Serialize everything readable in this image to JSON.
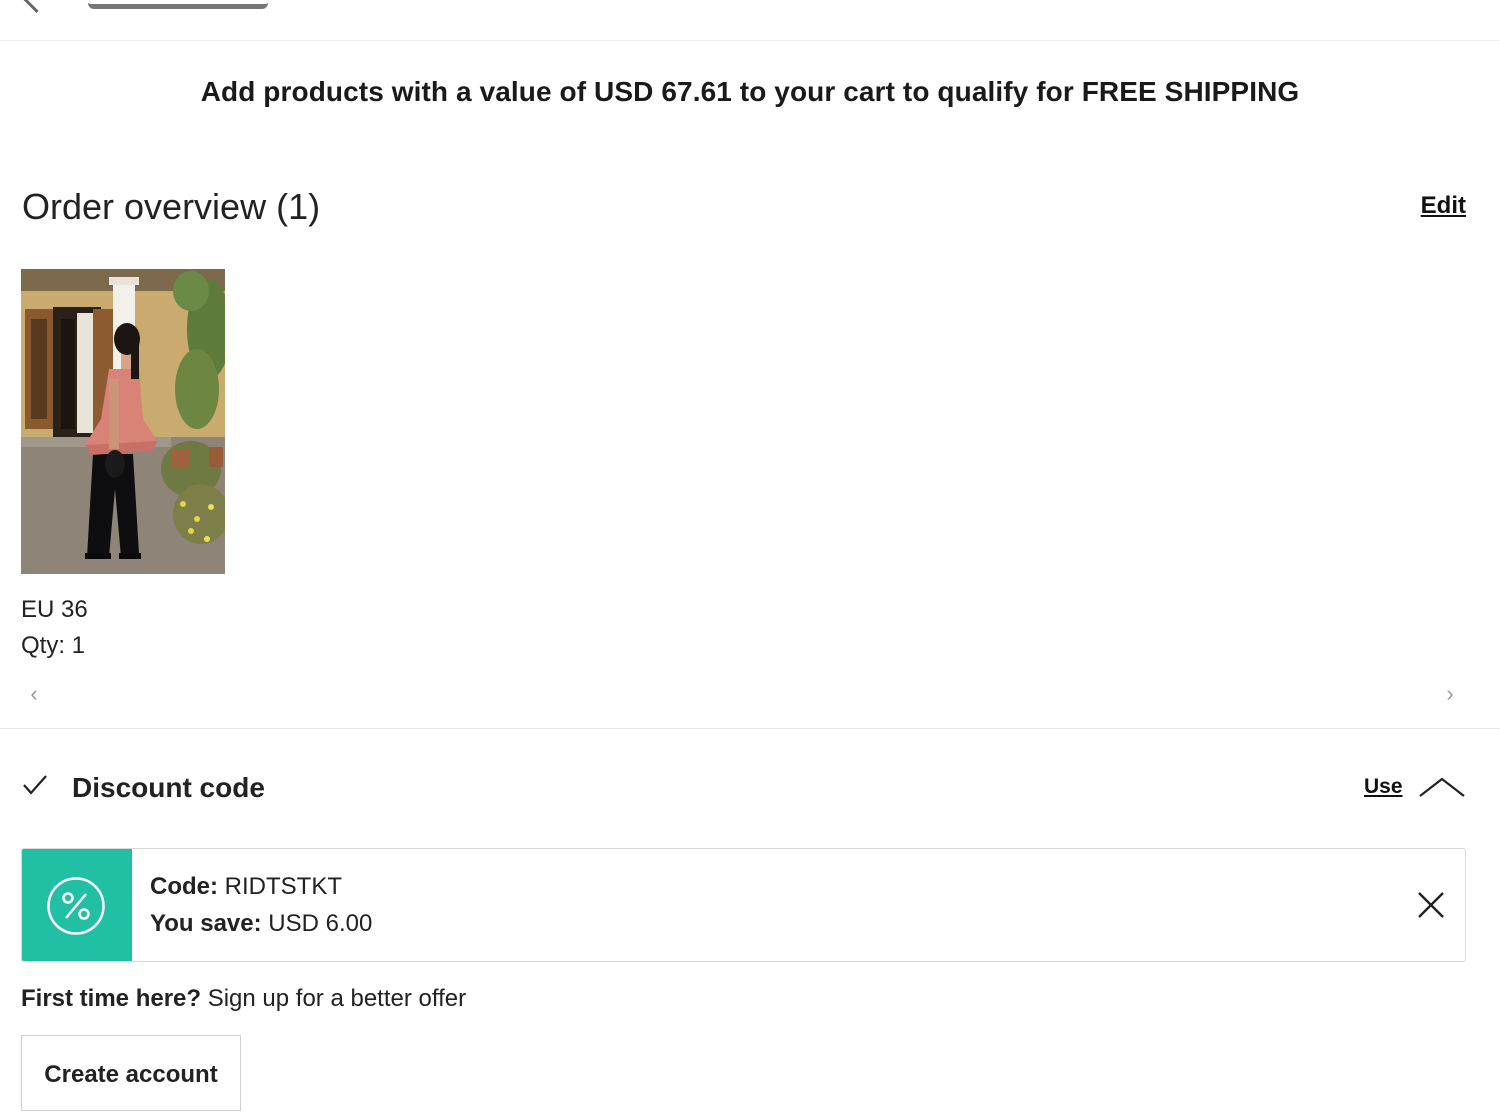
{
  "shipping_banner": {
    "text": "Add products with a value of USD 67.61 to your cart to qualify for FREE SHIPPING"
  },
  "order_overview": {
    "title": "Order overview (1)",
    "edit_label": "Edit",
    "items": [
      {
        "size": "EU 36",
        "qty": "Qty: 1"
      }
    ],
    "prev_icon": "chevron-left-icon",
    "next_icon": "chevron-right-icon"
  },
  "discount": {
    "title": "Discount code",
    "use_label": "Use",
    "check_icon": "check-icon",
    "collapse_icon": "chevron-up-icon",
    "applied": {
      "code_label": "Code:",
      "code_value": "RIDTSTKT",
      "save_label": "You save:",
      "save_value": "USD 6.00",
      "badge_icon": "percent-icon",
      "badge_color": "#21c0a5",
      "remove_icon": "close-icon"
    }
  },
  "signup": {
    "prompt_bold": "First time here?",
    "prompt_text": "Sign up for a better offer",
    "button_label": "Create account"
  }
}
